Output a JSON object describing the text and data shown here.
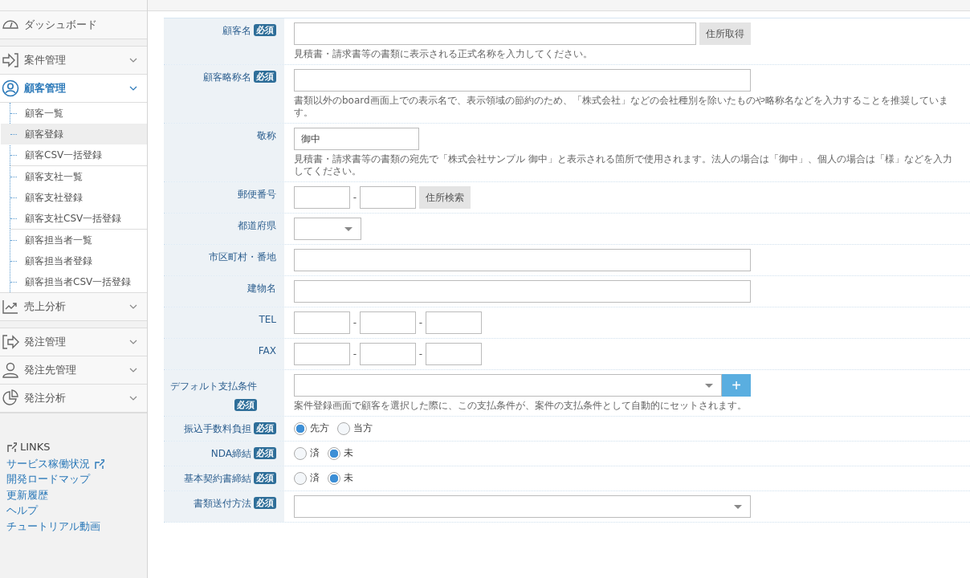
{
  "sidebar": {
    "sections": [
      [
        {
          "label": "ダッシュボード",
          "expandable": false,
          "active": false
        }
      ],
      [
        {
          "label": "案件管理",
          "expandable": true,
          "active": false
        },
        {
          "label": "顧客管理",
          "expandable": true,
          "active": true,
          "groups": [
            [
              {
                "label": "顧客一覧",
                "selected": false
              },
              {
                "label": "顧客登録",
                "selected": true
              },
              {
                "label": "顧客CSV一括登録",
                "selected": false
              }
            ],
            [
              {
                "label": "顧客支社一覧",
                "selected": false
              },
              {
                "label": "顧客支社登録",
                "selected": false
              },
              {
                "label": "顧客支社CSV一括登録",
                "selected": false
              }
            ],
            [
              {
                "label": "顧客担当者一覧",
                "selected": false
              },
              {
                "label": "顧客担当者登録",
                "selected": false
              },
              {
                "label": "顧客担当者CSV一括登録",
                "selected": false
              }
            ]
          ]
        },
        {
          "label": "売上分析",
          "expandable": true,
          "active": false
        }
      ],
      [
        {
          "label": "発注管理",
          "expandable": true,
          "active": false
        },
        {
          "label": "発注先管理",
          "expandable": true,
          "active": false
        },
        {
          "label": "発注分析",
          "expandable": true,
          "active": false
        }
      ]
    ],
    "links_title": "LINKS",
    "links": [
      {
        "label": "サービス稼働状況",
        "external": true
      },
      {
        "label": "開発ロードマップ",
        "external": false
      },
      {
        "label": "更新履歴",
        "external": false
      },
      {
        "label": "ヘルプ",
        "external": false
      },
      {
        "label": "チュートリアル動画",
        "external": false
      }
    ]
  },
  "form": {
    "rows": [
      {
        "kind": "text",
        "label": "顧客名",
        "required": "必須",
        "value": "",
        "button": "住所取得",
        "hint": "見積書・請求書等の書類に表示される正式名称を入力してください。"
      },
      {
        "kind": "text",
        "label": "顧客略称名",
        "required": "必須",
        "value": "",
        "hint": "書類以外のboard画面上での表示名で、表示領域の節約のため、「株式会社」などの会社種別を除いたものや略称名などを入力することを推奨しています。"
      },
      {
        "kind": "short_text",
        "label": "敬称",
        "value": "御中",
        "hint": "見積書・請求書等の書類の宛先で「株式会社サンプル 御中」と表示される箇所で使用されます。法人の場合は「御中」、個人の場合は「様」などを入力してください。"
      },
      {
        "kind": "zip",
        "label": "郵便番号",
        "separator": "-",
        "button": "住所検索"
      },
      {
        "kind": "short_select",
        "label": "都道府県"
      },
      {
        "kind": "text",
        "label": "市区町村・番地",
        "value": ""
      },
      {
        "kind": "text",
        "label": "建物名",
        "value": ""
      },
      {
        "kind": "phone",
        "label": "TEL",
        "separator": "-"
      },
      {
        "kind": "phone",
        "label": "FAX",
        "separator": "-"
      },
      {
        "kind": "select_add",
        "label": "デフォルト支払条件",
        "required": "必須",
        "add_button": "+",
        "hint": "案件登録画面で顧客を選択した際に、この支払条件が、案件の支払条件として自動的にセットされます。"
      },
      {
        "kind": "radio",
        "label": "振込手数料負担",
        "required": "必須",
        "options": [
          {
            "label": "先方",
            "selected": true
          },
          {
            "label": "当方",
            "selected": false
          }
        ]
      },
      {
        "kind": "radio",
        "label": "NDA締結",
        "required": "必須",
        "options": [
          {
            "label": "済",
            "selected": false
          },
          {
            "label": "未",
            "selected": true
          }
        ]
      },
      {
        "kind": "radio",
        "label": "基本契約書締結",
        "required": "必須",
        "options": [
          {
            "label": "済",
            "selected": false
          },
          {
            "label": "未",
            "selected": true
          }
        ]
      },
      {
        "kind": "select",
        "label": "書類送付方法",
        "required": "必須"
      }
    ]
  }
}
